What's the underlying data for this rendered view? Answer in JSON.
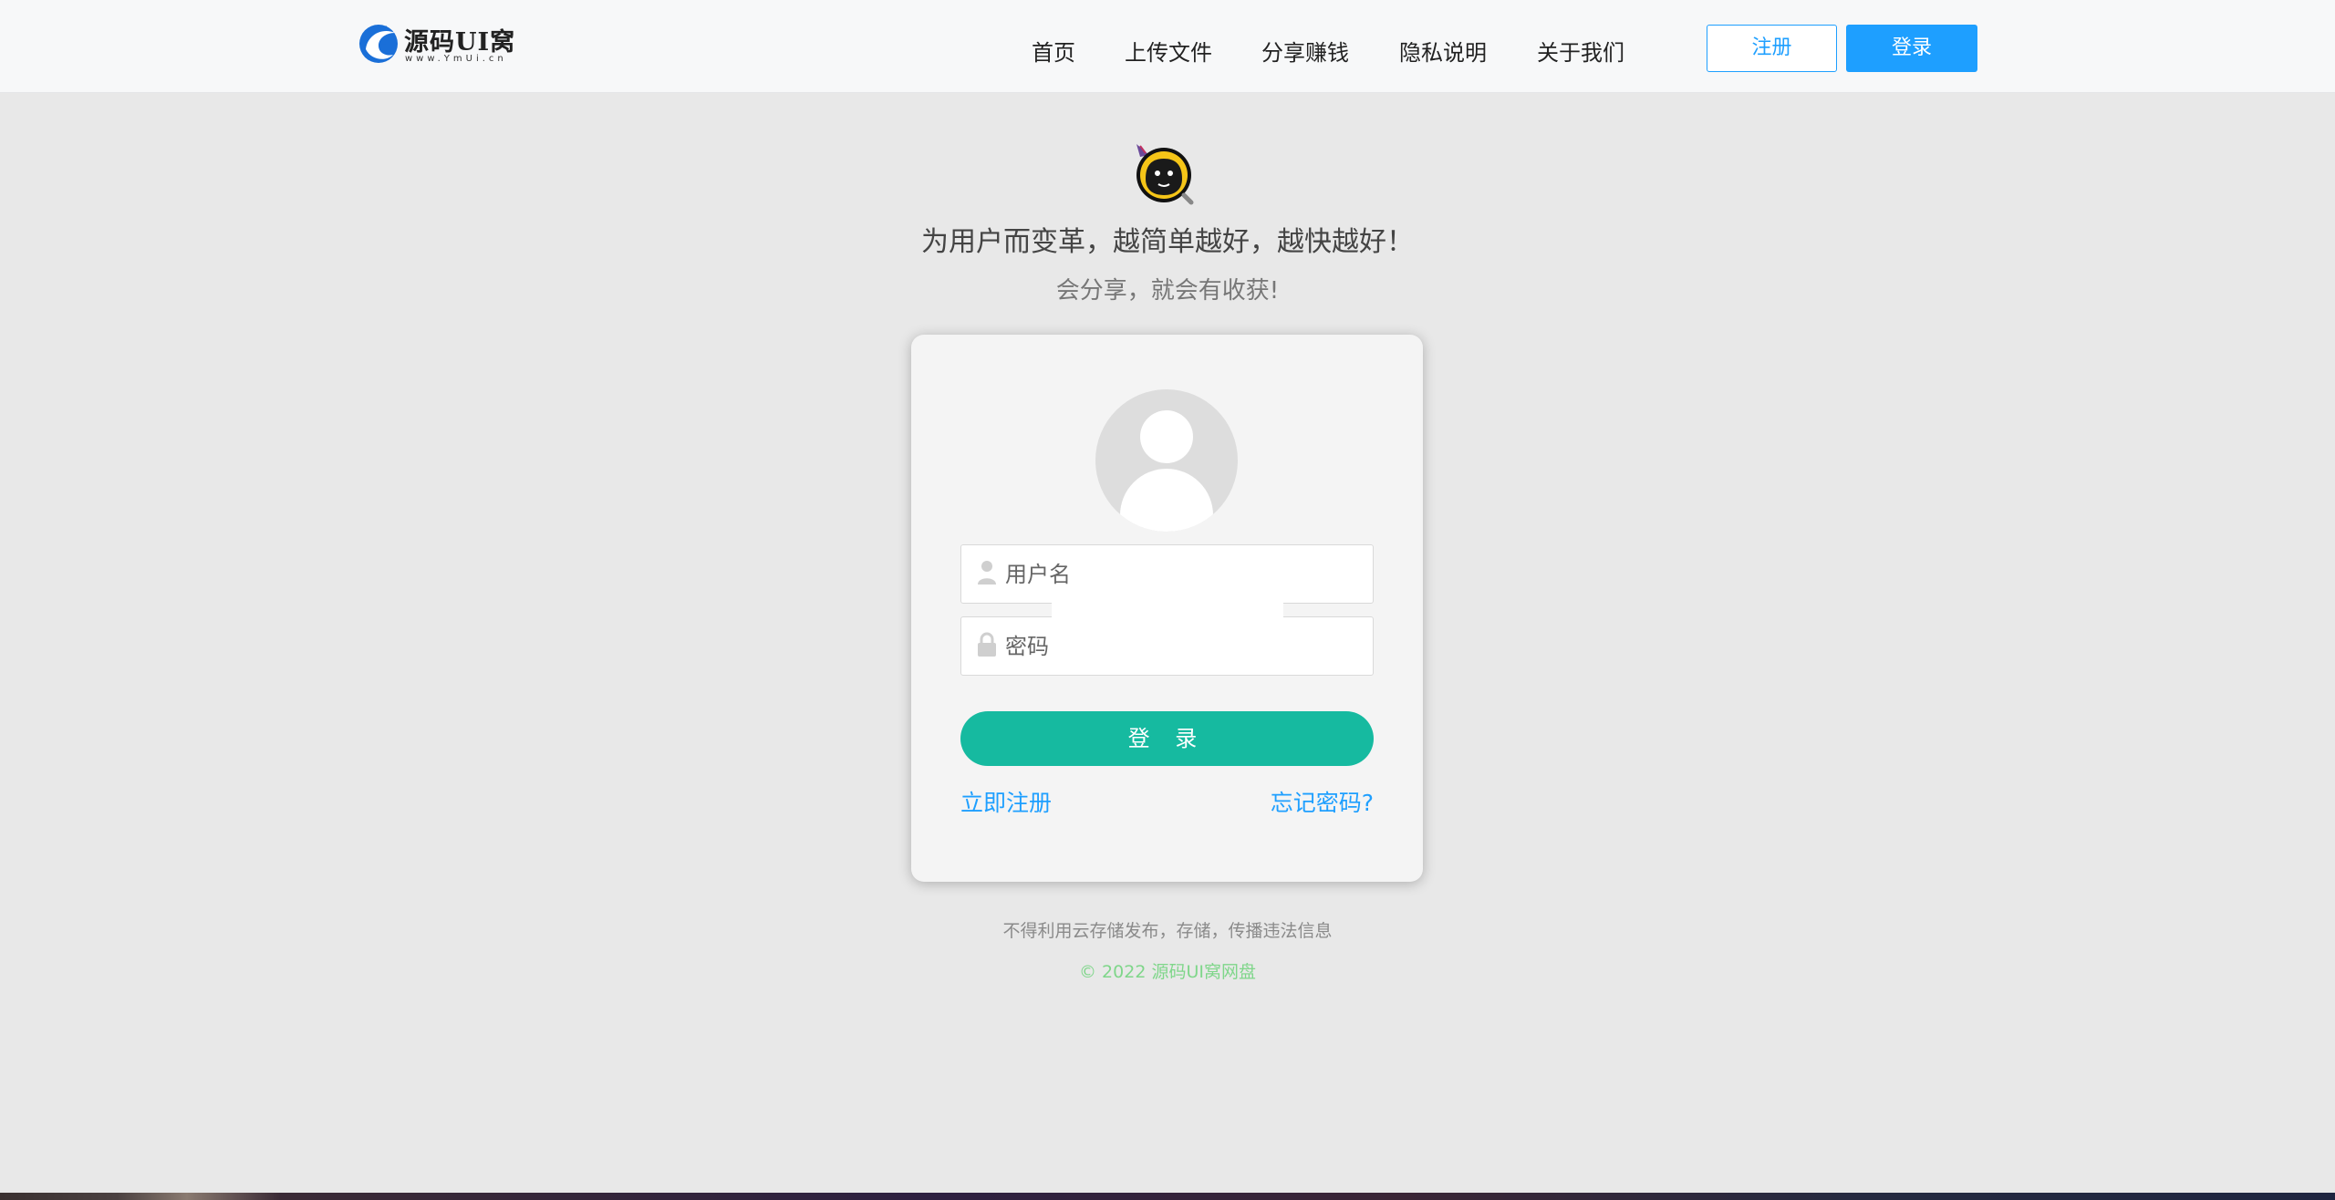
{
  "header": {
    "logo_text": "源码UI窝",
    "logo_sub": "www.YmUi.cn",
    "nav": [
      {
        "label": "首页"
      },
      {
        "label": "上传文件"
      },
      {
        "label": "分享赚钱"
      },
      {
        "label": "隐私说明"
      },
      {
        "label": "关于我们"
      }
    ],
    "register_label": "注册",
    "login_label": "登录"
  },
  "hero": {
    "slogan": "为用户而变革，越简单越好，越快越好！",
    "subslogan": "会分享，就会有收获!"
  },
  "login_form": {
    "username_placeholder": "用户名",
    "password_placeholder": "密码",
    "submit_label": "登 录",
    "register_link": "立即注册",
    "forgot_link": "忘记密码?"
  },
  "footer": {
    "notice": "不得利用云存储发布，存储，传播违法信息",
    "copyright": "© 2022 源码UI窝网盘"
  },
  "colors": {
    "accent_blue": "#1e9fff",
    "login_green": "#16baa0",
    "copyright_green": "#7fd68a"
  }
}
